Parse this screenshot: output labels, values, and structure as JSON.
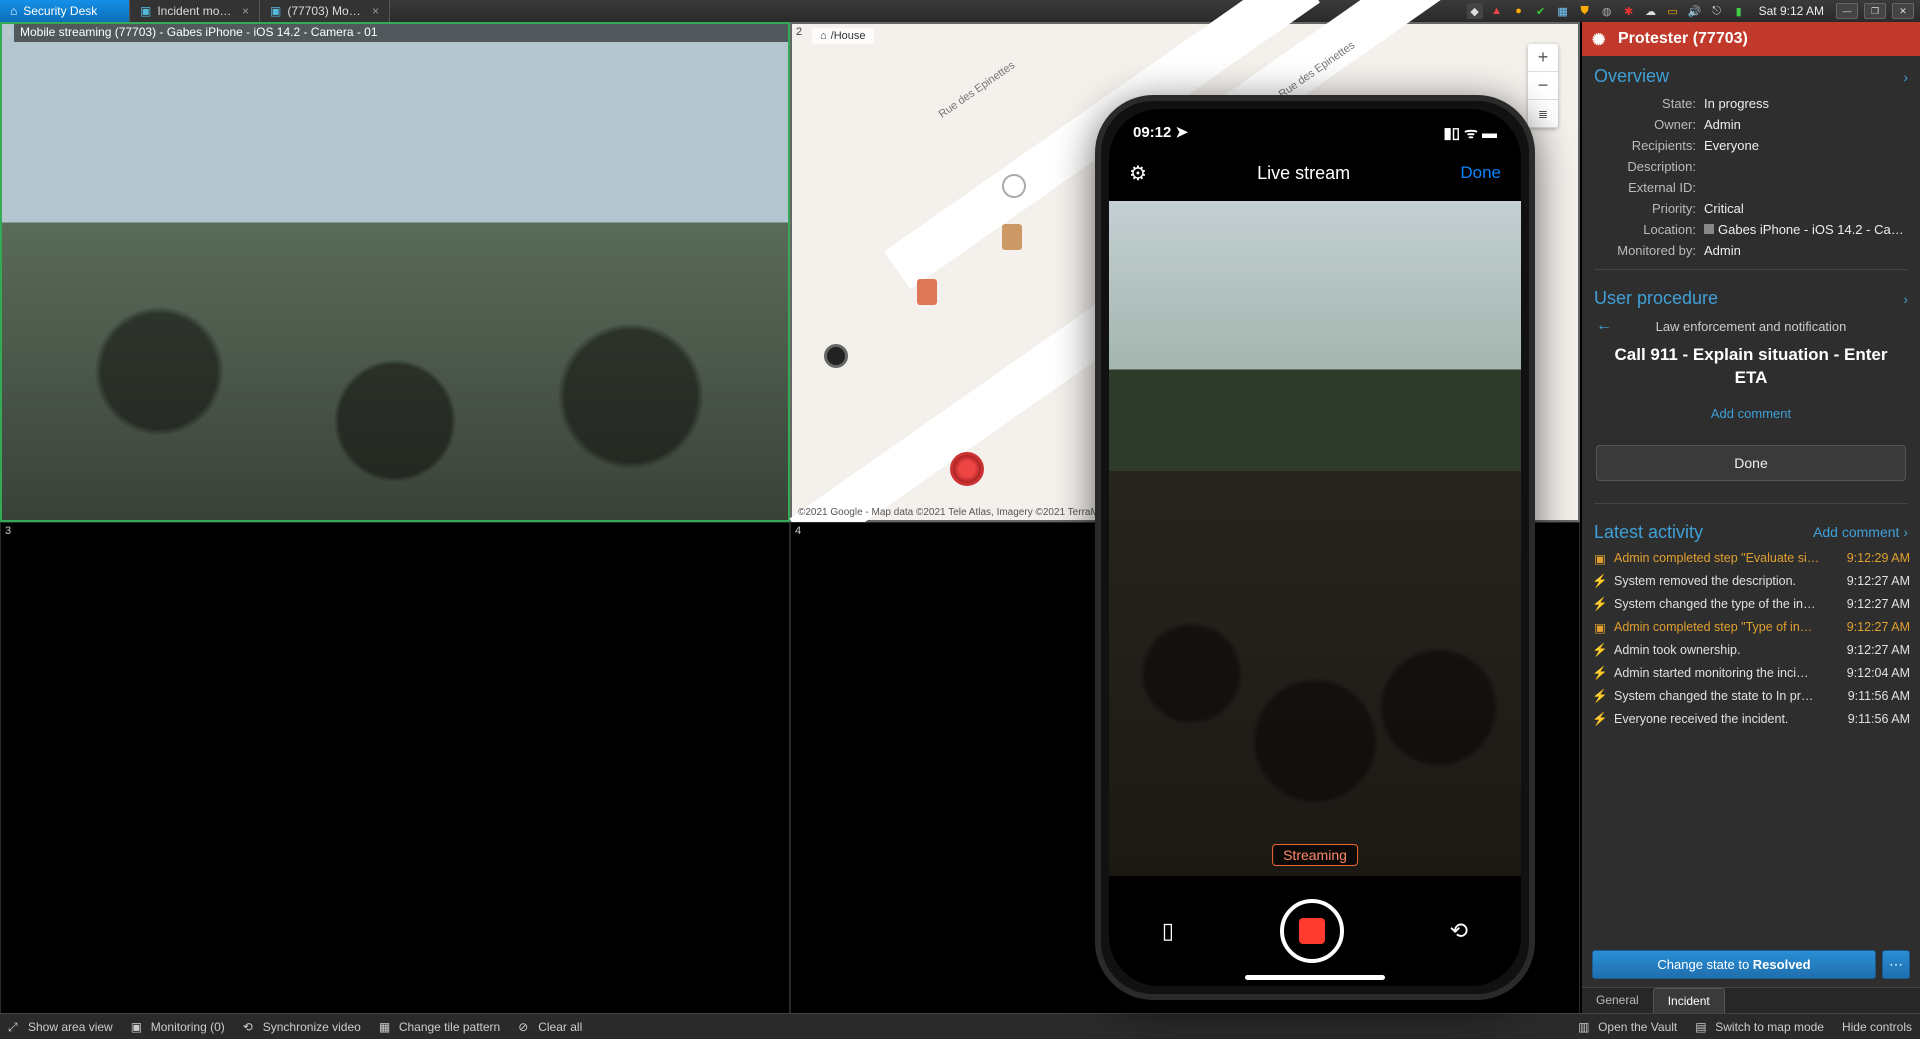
{
  "taskbar": {
    "tabs": [
      {
        "label": "Security Desk",
        "active": true
      },
      {
        "label": "Incident mo…",
        "active": false
      },
      {
        "label": "(77703) Mo…",
        "active": false
      }
    ],
    "clock": "Sat 9:12 AM"
  },
  "tiles": {
    "t1": {
      "index": "1",
      "header": "Mobile streaming (77703) - Gabes iPhone - iOS 14.2 - Camera - 01"
    },
    "t2": {
      "index": "2",
      "crumb_home": "⌂",
      "crumb_path": "/House",
      "street1": "Rue des Epinettes",
      "street2": "Rue des Epinettes",
      "zoom_in": "+",
      "zoom_out": "−",
      "attr": "©2021 Google - Map data ©2021 Tele Atlas, Imagery ©2021 TerraMetrics"
    },
    "t3": {
      "index": "3"
    },
    "t4": {
      "index": "4"
    }
  },
  "phone": {
    "time": "09:12",
    "bar_title": "Live stream",
    "done": "Done",
    "badge": "Streaming"
  },
  "incident": {
    "title": "Protester (77703)",
    "overview_label": "Overview",
    "fields": {
      "state_k": "State:",
      "state_v": "In progress",
      "owner_k": "Owner:",
      "owner_v": "Admin",
      "recipients_k": "Recipients:",
      "recipients_v": "Everyone",
      "description_k": "Description:",
      "description_v": "",
      "external_k": "External ID:",
      "external_v": "",
      "priority_k": "Priority:",
      "priority_v": "Critical",
      "location_k": "Location:",
      "location_v": "Gabes iPhone - iOS 14.2 - Camer…",
      "monitored_k": "Monitored by:",
      "monitored_v": "Admin"
    },
    "procedure": {
      "heading": "User procedure",
      "sub": "Law enforcement and notification",
      "main": "Call 911 - Explain situation - Enter ETA",
      "add_comment": "Add comment",
      "done": "Done"
    },
    "latest": {
      "heading": "Latest activity",
      "add": "Add comment",
      "items": [
        {
          "hl": true,
          "text": "Admin completed step \"Evaluate si…",
          "ts": "9:12:29 AM"
        },
        {
          "hl": false,
          "text": "System removed the description.",
          "ts": "9:12:27 AM"
        },
        {
          "hl": false,
          "text": "System changed the type of the in…",
          "ts": "9:12:27 AM"
        },
        {
          "hl": true,
          "text": "Admin completed step \"Type of in…",
          "ts": "9:12:27 AM"
        },
        {
          "hl": false,
          "text": "Admin took ownership.",
          "ts": "9:12:27 AM"
        },
        {
          "hl": false,
          "text": "Admin started monitoring the inci…",
          "ts": "9:12:04 AM"
        },
        {
          "hl": false,
          "text": "System changed the state to In pr…",
          "ts": "9:11:56 AM"
        },
        {
          "hl": false,
          "text": "Everyone received the incident.",
          "ts": "9:11:56 AM"
        }
      ]
    },
    "state_btn_prefix": "Change state to  ",
    "state_btn_value": "Resolved",
    "tabs": {
      "general": "General",
      "incident": "Incident"
    }
  },
  "statusbar": {
    "show_area": "Show area view",
    "monitoring": "Monitoring (0)",
    "sync": "Synchronize video",
    "pattern": "Change tile pattern",
    "clear": "Clear all",
    "vault": "Open the Vault",
    "mapmode": "Switch to map mode",
    "hide": "Hide controls"
  }
}
